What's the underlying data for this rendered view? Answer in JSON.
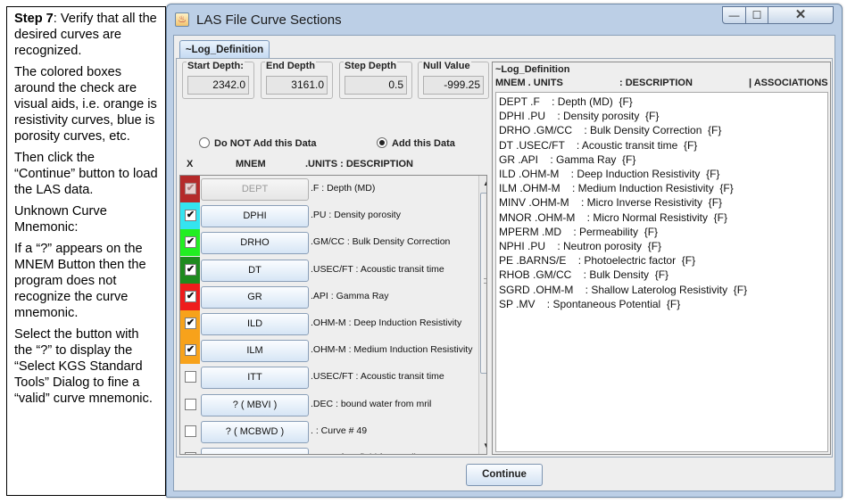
{
  "instructions": {
    "step_bold": "Step 7",
    "p1_rest": ": Verify that all the desired curves are recognized.",
    "p2": "The colored boxes around the check are visual aids, i.e. orange is resistivity curves, blue is porosity curves, etc.",
    "p3": "Then click the “Continue” button to load the LAS data.",
    "p4": "Unknown Curve Mnemonic:",
    "p5": "If a “?” appears on the MNEM Button then the program does not recognize the curve mnemonic.",
    "p6": "Select the button with the “?” to display the “Select KGS Standard Tools” Dialog to fine a “valid” curve mnemonic."
  },
  "window": {
    "title": "LAS File Curve Sections",
    "icon": "las-app-icon"
  },
  "tab": {
    "label": "~Log_Definition"
  },
  "fields": {
    "start_label": "Start Depth:",
    "start_value": "2342.0",
    "end_label": "End Depth",
    "end_value": "3161.0",
    "step_label": "Step Depth",
    "step_value": "0.5",
    "null_label": "Null Value",
    "null_value": "-999.25"
  },
  "radios": {
    "no_add": "Do NOT Add this Data",
    "add": "Add this Data",
    "selected": "add"
  },
  "headers": {
    "x": "X",
    "mnem": "MNEM",
    "units_desc": ".UNITS  : DESCRIPTION"
  },
  "curves": [
    {
      "mnem": "DEPT",
      "desc": ".F : Depth (MD)",
      "color": "#b52a2a",
      "checked": true,
      "disabled": true
    },
    {
      "mnem": "DPHI",
      "desc": ".PU : Density porosity",
      "color": "#34e4f0",
      "checked": true,
      "disabled": false
    },
    {
      "mnem": "DRHO",
      "desc": ".GM/CC : Bulk Density Correction",
      "color": "#22ee22",
      "checked": true,
      "disabled": false
    },
    {
      "mnem": "DT",
      "desc": ".USEC/FT : Acoustic transit time",
      "color": "#1e8a1e",
      "checked": true,
      "disabled": false
    },
    {
      "mnem": "GR",
      "desc": ".API : Gamma Ray",
      "color": "#ee1c1c",
      "checked": true,
      "disabled": false
    },
    {
      "mnem": "ILD",
      "desc": ".OHM-M : Deep Induction Resistivity",
      "color": "#f7a21b",
      "checked": true,
      "disabled": false
    },
    {
      "mnem": "ILM",
      "desc": ".OHM-M : Medium Induction Resistivity",
      "color": "#f7a21b",
      "checked": true,
      "disabled": false
    },
    {
      "mnem": "ITT",
      "desc": ".USEC/FT : Acoustic transit time",
      "color": "",
      "checked": false,
      "disabled": false
    },
    {
      "mnem": "? ( MBVI )",
      "desc": ".DEC : bound water from mril",
      "color": "",
      "checked": false,
      "disabled": false
    },
    {
      "mnem": "? ( MCBWD )",
      "desc": ". : Curve #  49",
      "color": "",
      "checked": false,
      "disabled": false
    },
    {
      "mnem": "? ( MFFI )",
      "desc": ".DEC : free fluid from mril",
      "color": "",
      "checked": false,
      "disabled": false
    },
    {
      "mnem": "",
      "desc": "",
      "color": "#f7a21b",
      "checked": false,
      "disabled": false
    }
  ],
  "las": {
    "section": "~Log_Definition",
    "col_mnem": "MNEM . UNITS",
    "col_desc": ": DESCRIPTION",
    "col_assoc": "| ASSOCIATIONS",
    "lines": [
      "DEPT .F    : Depth (MD)  {F}",
      "DPHI .PU    : Density porosity  {F}",
      "DRHO .GM/CC    : Bulk Density Correction  {F}",
      "DT .USEC/FT    : Acoustic transit time  {F}",
      "GR .API    : Gamma Ray  {F}",
      "ILD .OHM-M    : Deep Induction Resistivity  {F}",
      "ILM .OHM-M    : Medium Induction Resistivity  {F}",
      "MINV .OHM-M    : Micro Inverse Resistivity  {F}",
      "MNOR .OHM-M    : Micro Normal Resistivity  {F}",
      "MPERM .MD    : Permeability  {F}",
      "NPHI .PU    : Neutron porosity  {F}",
      "PE .BARNS/E    : Photoelectric factor  {F}",
      "RHOB .GM/CC    : Bulk Density  {F}",
      "SGRD .OHM-M    : Shallow Laterolog Resistivity  {F}",
      "SP .MV    : Spontaneous Potential  {F}"
    ]
  },
  "buttons": {
    "continue": "Continue"
  }
}
